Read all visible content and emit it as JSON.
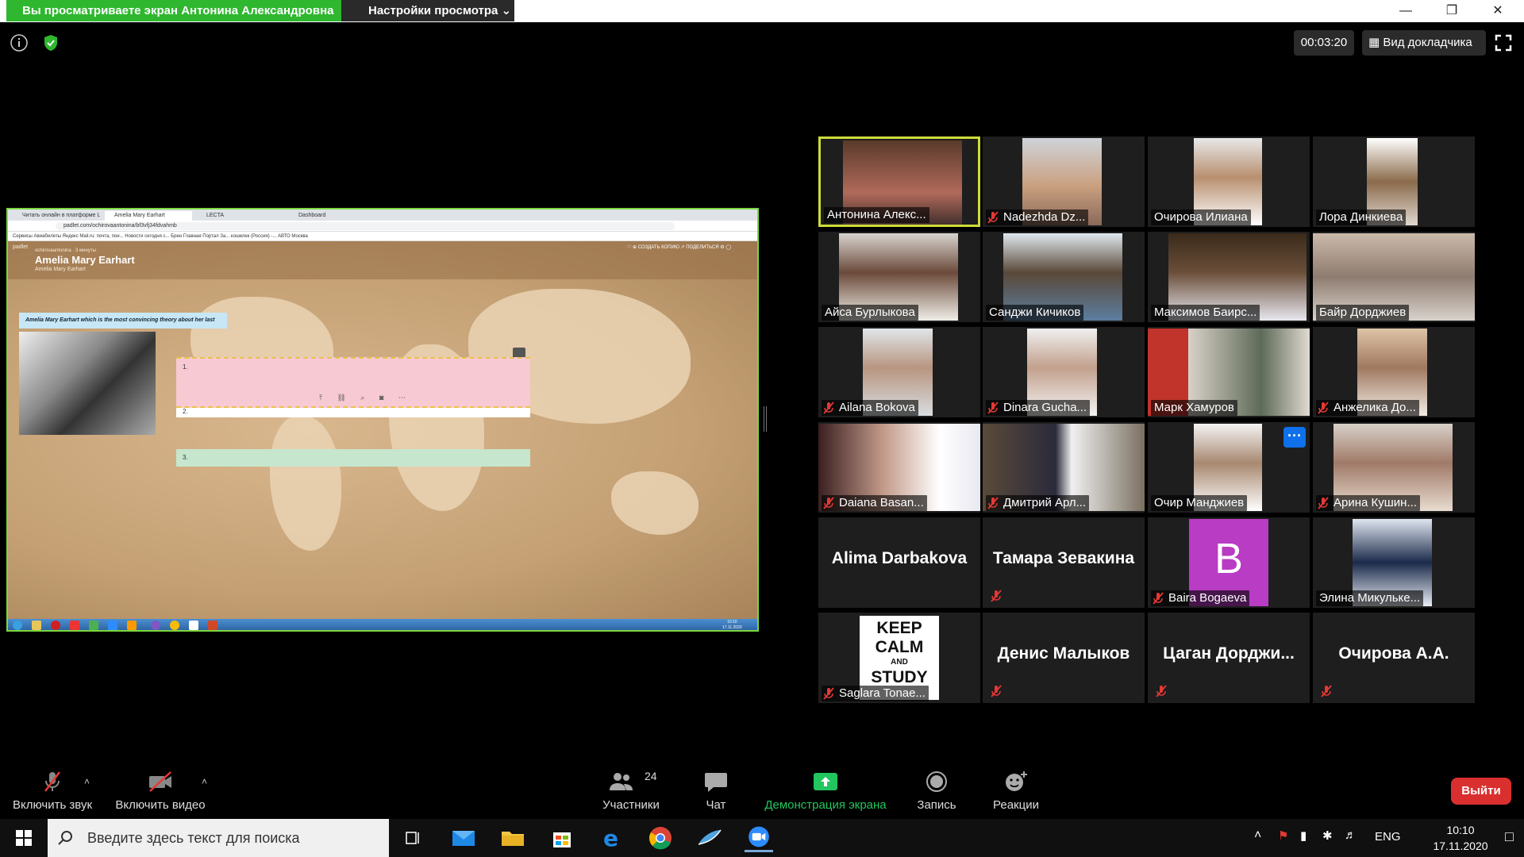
{
  "banner": {
    "sharing_text": "Вы просматриваете экран Антонина Александровна",
    "view_settings_label": "Настройки просмотра ⌄"
  },
  "meeting": {
    "timer": "00:03:20",
    "speaker_view_label": "Вид докладчика"
  },
  "shared_screen": {
    "browser_tabs": [
      "Читать онлайн в платформе Li",
      "Amelia Mary Earhart",
      "LECTA",
      "Dashboard"
    ],
    "url": "padlet.com/ochirovaantonina/bf3vfj34fdvahmb",
    "bookmarks": "Сервисы  Авиабилеты  Яндекс  Mail.ru: почта, пои...  Новости сегодня с...  Брен  Главная Портал За...  кошелек (Россия) -...  АВТО  Москва",
    "padlet_brand": "padlet",
    "padlet_author": "ochirovaantonina · 3 минуты",
    "padlet_title": "Amelia Mary Earhart",
    "padlet_subtitle": "Amelia Mary Earhart",
    "padlet_actions": "♡  ⊕ СОЗДАТЬ КОПИЮ   ↗ ПОДЕЛИТЬСЯ   ⚙   ◯",
    "question": "Amelia Mary Earhart which is the most convincing theory about her last flight",
    "card1_num": "1.",
    "card2_num": "2.",
    "card3_num": "3.",
    "card_tools": "⤒ ⛓ ⌕ ◙ ⋯",
    "w7_clock": "10:10\n17.11.2020",
    "w7_lang": "EN"
  },
  "participants": [
    {
      "name": "Антонина Алекс...",
      "muted": false,
      "active": true
    },
    {
      "name": "Nadezhda Dz...",
      "muted": true
    },
    {
      "name": "Очирова Илиана",
      "muted": false
    },
    {
      "name": "Лора Динкиева",
      "muted": false
    },
    {
      "name": "Айса Бурлыкова",
      "muted": false
    },
    {
      "name": "Санджи Кичиков",
      "muted": false
    },
    {
      "name": "Максимов Баирс...",
      "muted": false
    },
    {
      "name": "Байр Дорджиев",
      "muted": false
    },
    {
      "name": "Ailana Bokova",
      "muted": true
    },
    {
      "name": "Dinara Gucha...",
      "muted": true
    },
    {
      "name": "Марк Хамуров",
      "muted": false
    },
    {
      "name": "Анжелика До...",
      "muted": true
    },
    {
      "name": "Daiana Basan...",
      "muted": true
    },
    {
      "name": "Дмитрий Арл...",
      "muted": true
    },
    {
      "name": "Очир Манджиев",
      "muted": false
    },
    {
      "name": "Арина Кушин...",
      "muted": true
    },
    {
      "name": "Alima Darbakova",
      "muted": false,
      "no_video": true
    },
    {
      "name": "Тамара Зевакина",
      "muted": true,
      "no_video": true
    },
    {
      "name": "Baira Bogaeva",
      "muted": true,
      "avatar_letter": "B"
    },
    {
      "name": "Элина Микульке...",
      "muted": false
    },
    {
      "name": "Saglara Tonae...",
      "muted": true,
      "poster": "KEEP CALM AND STUDY"
    },
    {
      "name": "Денис Малыков",
      "muted": true,
      "no_video": true
    },
    {
      "name": "Цаган Дорджи...",
      "muted": true,
      "no_video": true
    },
    {
      "name": "Очирова А.А.",
      "muted": true,
      "no_video": true
    }
  ],
  "poster_lines": [
    "KEEP",
    "CALM",
    "AND",
    "STUDY"
  ],
  "avatar_letter": "B",
  "more_button": "···",
  "toolbar": {
    "unmute": "Включить звук",
    "start_video": "Включить видео",
    "participants": "Участники",
    "participants_count": "24",
    "chat": "Чат",
    "share_screen": "Демонстрация экрана",
    "record": "Запись",
    "reactions": "Реакции",
    "leave": "Выйти"
  },
  "taskbar": {
    "search_placeholder": "Введите здесь текст для поиска",
    "lang": "ENG",
    "time": "10:10",
    "date": "17.11.2020"
  },
  "colors": {
    "zoom_green": "#2fb72f",
    "active_border": "#cddc39",
    "leave_red": "#d9302f",
    "share_green": "#22c55e"
  }
}
